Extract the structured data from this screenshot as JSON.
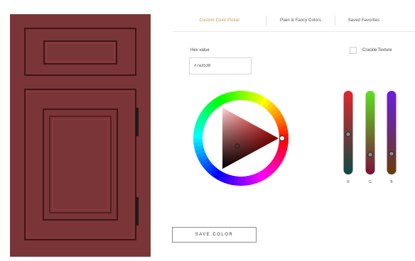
{
  "tabs": [
    {
      "label": "Custom Color Picker",
      "active": true
    },
    {
      "label": "Plain & Fancy Colors",
      "active": false
    },
    {
      "label": "Saved Favorites",
      "active": false
    }
  ],
  "hex": {
    "label": "Hex value",
    "value": "#7a3538"
  },
  "crackle": {
    "label": "Crackle Texture",
    "checked": false
  },
  "rgb_sliders": [
    {
      "label": "R",
      "value": 122,
      "color": "#e0262c"
    },
    {
      "label": "G",
      "value": 53,
      "color": "#5ce01f"
    },
    {
      "label": "B",
      "value": 56,
      "color": "#6a1fe0"
    }
  ],
  "colors": {
    "door": "#7a3538",
    "accent": "#c19a4a"
  },
  "save_button": "SAVE COLOR"
}
